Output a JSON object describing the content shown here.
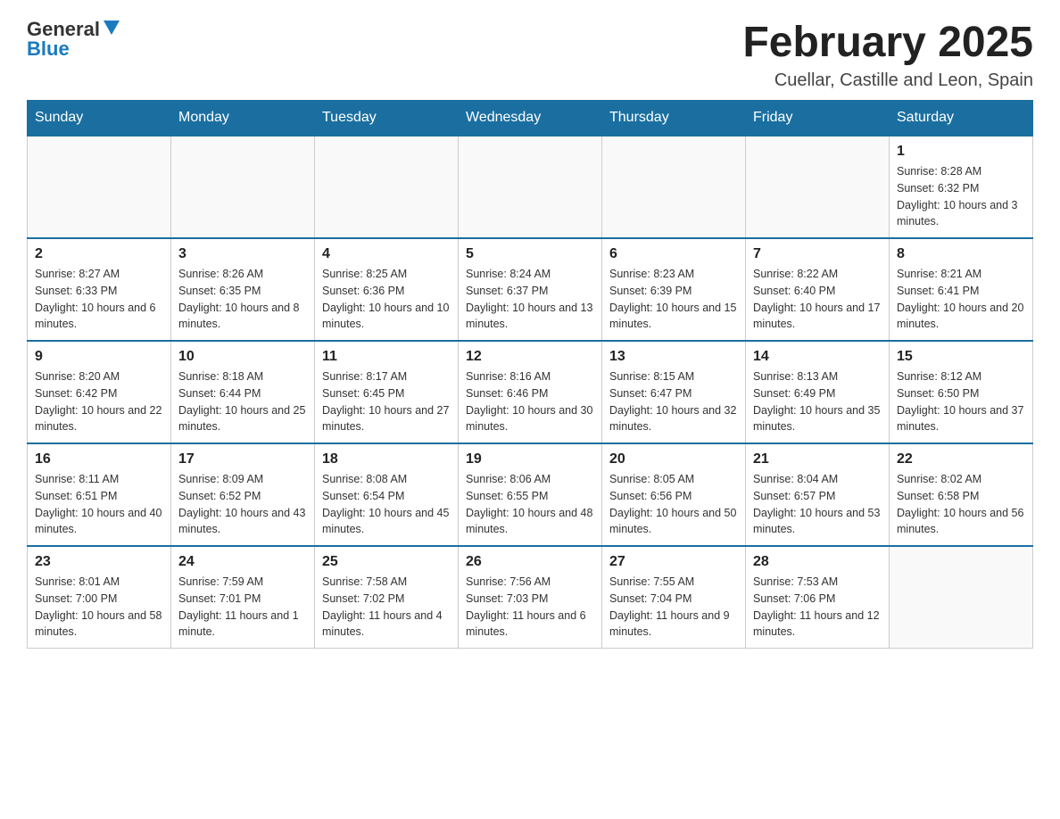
{
  "header": {
    "logo": {
      "general": "General",
      "blue": "Blue"
    },
    "title": "February 2025",
    "location": "Cuellar, Castille and Leon, Spain"
  },
  "days_of_week": [
    "Sunday",
    "Monday",
    "Tuesday",
    "Wednesday",
    "Thursday",
    "Friday",
    "Saturday"
  ],
  "weeks": [
    [
      {
        "day": "",
        "info": ""
      },
      {
        "day": "",
        "info": ""
      },
      {
        "day": "",
        "info": ""
      },
      {
        "day": "",
        "info": ""
      },
      {
        "day": "",
        "info": ""
      },
      {
        "day": "",
        "info": ""
      },
      {
        "day": "1",
        "info": "Sunrise: 8:28 AM\nSunset: 6:32 PM\nDaylight: 10 hours and 3 minutes."
      }
    ],
    [
      {
        "day": "2",
        "info": "Sunrise: 8:27 AM\nSunset: 6:33 PM\nDaylight: 10 hours and 6 minutes."
      },
      {
        "day": "3",
        "info": "Sunrise: 8:26 AM\nSunset: 6:35 PM\nDaylight: 10 hours and 8 minutes."
      },
      {
        "day": "4",
        "info": "Sunrise: 8:25 AM\nSunset: 6:36 PM\nDaylight: 10 hours and 10 minutes."
      },
      {
        "day": "5",
        "info": "Sunrise: 8:24 AM\nSunset: 6:37 PM\nDaylight: 10 hours and 13 minutes."
      },
      {
        "day": "6",
        "info": "Sunrise: 8:23 AM\nSunset: 6:39 PM\nDaylight: 10 hours and 15 minutes."
      },
      {
        "day": "7",
        "info": "Sunrise: 8:22 AM\nSunset: 6:40 PM\nDaylight: 10 hours and 17 minutes."
      },
      {
        "day": "8",
        "info": "Sunrise: 8:21 AM\nSunset: 6:41 PM\nDaylight: 10 hours and 20 minutes."
      }
    ],
    [
      {
        "day": "9",
        "info": "Sunrise: 8:20 AM\nSunset: 6:42 PM\nDaylight: 10 hours and 22 minutes."
      },
      {
        "day": "10",
        "info": "Sunrise: 8:18 AM\nSunset: 6:44 PM\nDaylight: 10 hours and 25 minutes."
      },
      {
        "day": "11",
        "info": "Sunrise: 8:17 AM\nSunset: 6:45 PM\nDaylight: 10 hours and 27 minutes."
      },
      {
        "day": "12",
        "info": "Sunrise: 8:16 AM\nSunset: 6:46 PM\nDaylight: 10 hours and 30 minutes."
      },
      {
        "day": "13",
        "info": "Sunrise: 8:15 AM\nSunset: 6:47 PM\nDaylight: 10 hours and 32 minutes."
      },
      {
        "day": "14",
        "info": "Sunrise: 8:13 AM\nSunset: 6:49 PM\nDaylight: 10 hours and 35 minutes."
      },
      {
        "day": "15",
        "info": "Sunrise: 8:12 AM\nSunset: 6:50 PM\nDaylight: 10 hours and 37 minutes."
      }
    ],
    [
      {
        "day": "16",
        "info": "Sunrise: 8:11 AM\nSunset: 6:51 PM\nDaylight: 10 hours and 40 minutes."
      },
      {
        "day": "17",
        "info": "Sunrise: 8:09 AM\nSunset: 6:52 PM\nDaylight: 10 hours and 43 minutes."
      },
      {
        "day": "18",
        "info": "Sunrise: 8:08 AM\nSunset: 6:54 PM\nDaylight: 10 hours and 45 minutes."
      },
      {
        "day": "19",
        "info": "Sunrise: 8:06 AM\nSunset: 6:55 PM\nDaylight: 10 hours and 48 minutes."
      },
      {
        "day": "20",
        "info": "Sunrise: 8:05 AM\nSunset: 6:56 PM\nDaylight: 10 hours and 50 minutes."
      },
      {
        "day": "21",
        "info": "Sunrise: 8:04 AM\nSunset: 6:57 PM\nDaylight: 10 hours and 53 minutes."
      },
      {
        "day": "22",
        "info": "Sunrise: 8:02 AM\nSunset: 6:58 PM\nDaylight: 10 hours and 56 minutes."
      }
    ],
    [
      {
        "day": "23",
        "info": "Sunrise: 8:01 AM\nSunset: 7:00 PM\nDaylight: 10 hours and 58 minutes."
      },
      {
        "day": "24",
        "info": "Sunrise: 7:59 AM\nSunset: 7:01 PM\nDaylight: 11 hours and 1 minute."
      },
      {
        "day": "25",
        "info": "Sunrise: 7:58 AM\nSunset: 7:02 PM\nDaylight: 11 hours and 4 minutes."
      },
      {
        "day": "26",
        "info": "Sunrise: 7:56 AM\nSunset: 7:03 PM\nDaylight: 11 hours and 6 minutes."
      },
      {
        "day": "27",
        "info": "Sunrise: 7:55 AM\nSunset: 7:04 PM\nDaylight: 11 hours and 9 minutes."
      },
      {
        "day": "28",
        "info": "Sunrise: 7:53 AM\nSunset: 7:06 PM\nDaylight: 11 hours and 12 minutes."
      },
      {
        "day": "",
        "info": ""
      }
    ]
  ]
}
